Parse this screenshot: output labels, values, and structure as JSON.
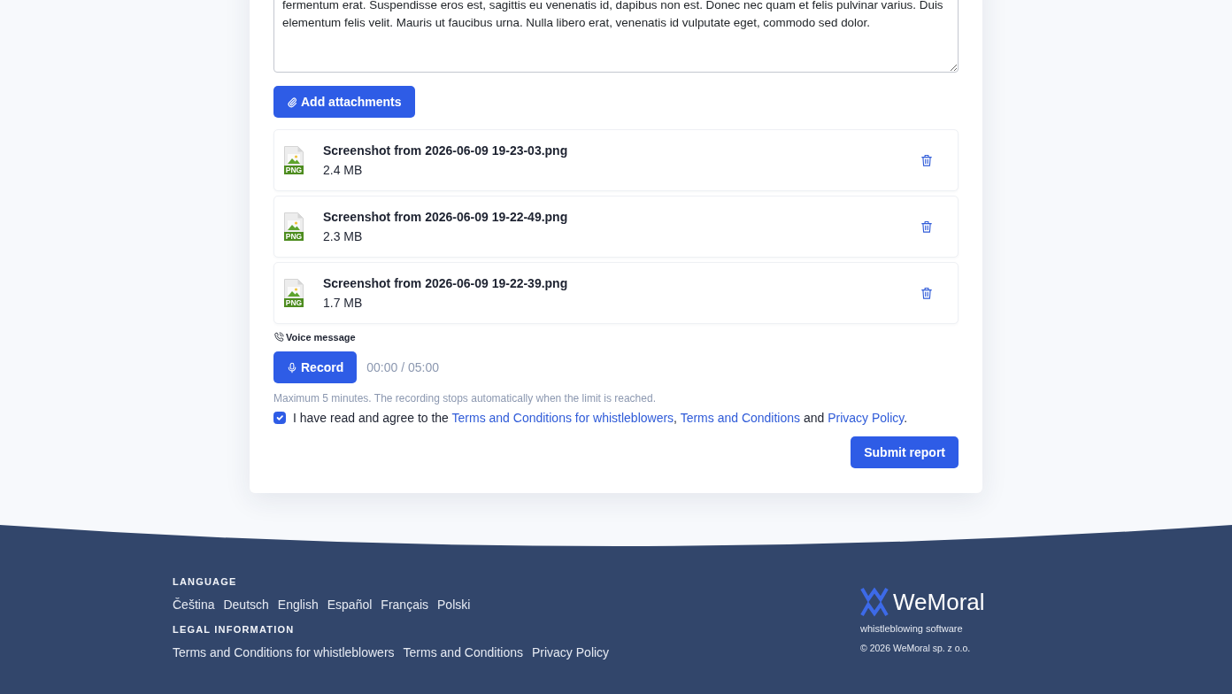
{
  "report_form": {
    "description": {
      "value": "fermentum erat. Suspendisse eros est, sagittis eu venenatis id, dapibus non est. Donec nec quam et felis pulvinar varius. Duis elementum felis velit. Mauris ut faucibus urna. Nulla libero erat, venenatis id vulputate eget, commodo sed dolor."
    },
    "add_attachments_button": "Add attachments",
    "attachments": [
      {
        "name": "Screenshot from 2026-06-09 19-23-03.png",
        "size": "2.4 MB",
        "file_type": "PNG"
      },
      {
        "name": "Screenshot from 2026-06-09 19-22-49.png",
        "size": "2.3 MB",
        "file_type": "PNG"
      },
      {
        "name": "Screenshot from 2026-06-09 19-22-39.png",
        "size": "1.7 MB",
        "file_type": "PNG"
      }
    ],
    "voice_message": {
      "label": "Voice message",
      "record_button": "Record",
      "timer": "00:00 / 05:00",
      "hint": "Maximum 5 minutes. The recording stops automatically when the limit is reached."
    },
    "consent": {
      "checked": true,
      "parts": [
        {
          "kind": "text",
          "text": "I have read and agree to the "
        },
        {
          "kind": "link",
          "text": "Terms and Conditions for whistleblowers"
        },
        {
          "kind": "text",
          "text": ", "
        },
        {
          "kind": "link",
          "text": "Terms and Conditions"
        },
        {
          "kind": "text",
          "text": " and "
        },
        {
          "kind": "link",
          "text": "Privacy Policy"
        },
        {
          "kind": "text",
          "text": "."
        }
      ]
    },
    "submit_button": "Submit report"
  },
  "footer": {
    "language_heading": "LANGUAGE",
    "languages": [
      "Čeština",
      "Deutsch",
      "English",
      "Español",
      "Français",
      "Polski"
    ],
    "legal_heading": "LEGAL INFORMATION",
    "legal_links": [
      "Terms and Conditions for whistleblowers",
      "Terms and Conditions",
      "Privacy Policy"
    ],
    "brand": "WeMoral",
    "tagline": "whistleblowing software",
    "copyright": "© 2026 WeMoral sp. z o.o."
  }
}
